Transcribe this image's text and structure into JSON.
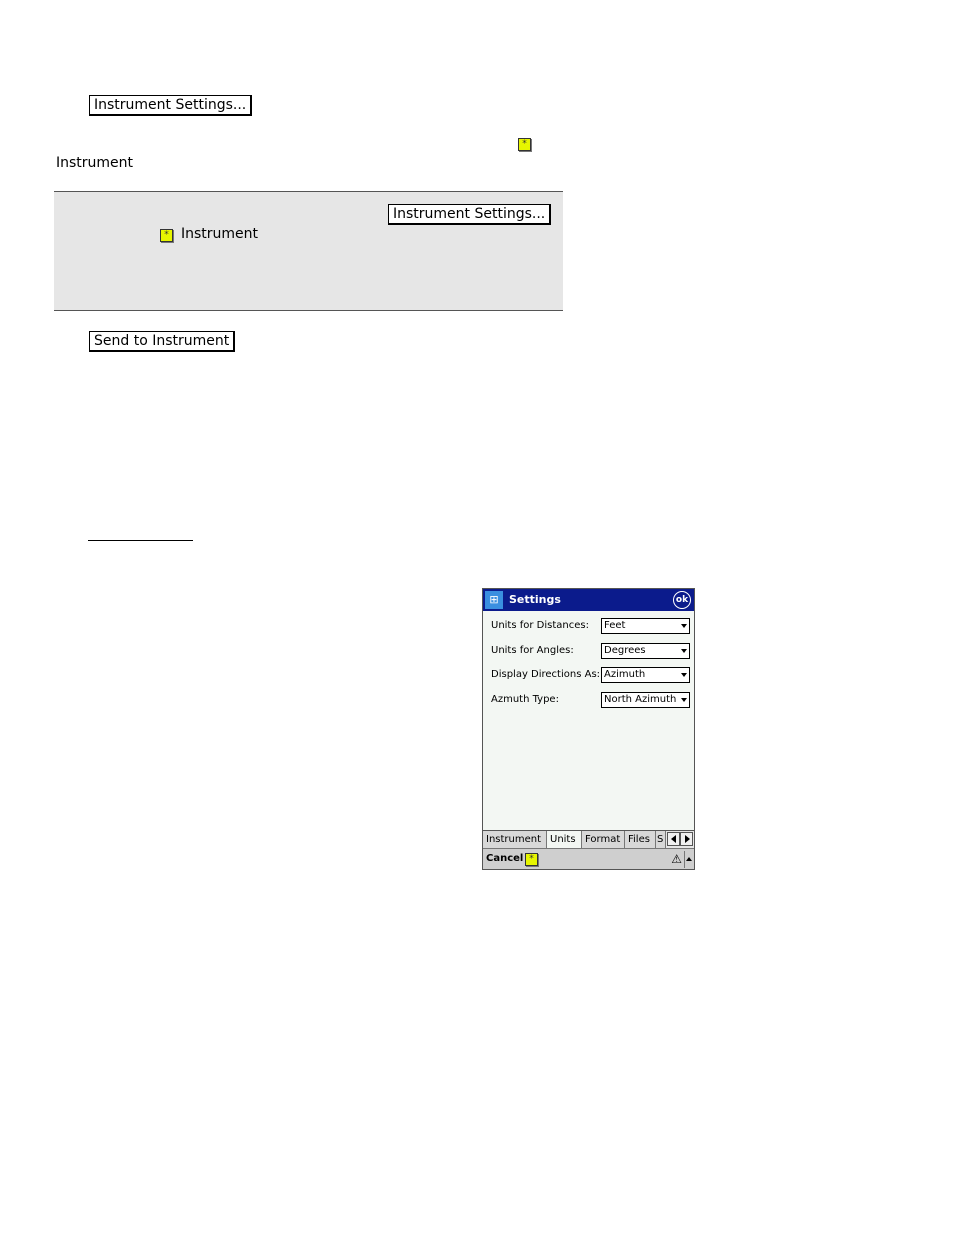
{
  "doc": {
    "btn_instrument_settings_top": "Instrument Settings...",
    "instrument_label": "Instrument",
    "note": {
      "btn_instrument_settings": "Instrument Settings...",
      "instrument_label": "Instrument"
    },
    "btn_send_to_instrument": "Send to Instrument"
  },
  "device": {
    "title": "Settings",
    "ok_label": "ok",
    "rows": [
      {
        "label": "Units for Distances:",
        "value": "Feet"
      },
      {
        "label": "Units for Angles:",
        "value": "Degrees"
      },
      {
        "label": "Display Directions As:",
        "value": "Azimuth"
      },
      {
        "label": "Azmuth Type:",
        "value": "North Azimuth"
      }
    ],
    "tabs": [
      "Instrument",
      "Units",
      "Format",
      "Files",
      "S"
    ],
    "active_tab": "Units",
    "cancel_label": "Cancel"
  },
  "icons": {
    "star": "*",
    "start": "⊞",
    "sip": "⚠"
  },
  "colors": {
    "title_bar": "#0b1b8c",
    "star_icon": "#e6f500",
    "note_bg": "#e6e6e6"
  }
}
